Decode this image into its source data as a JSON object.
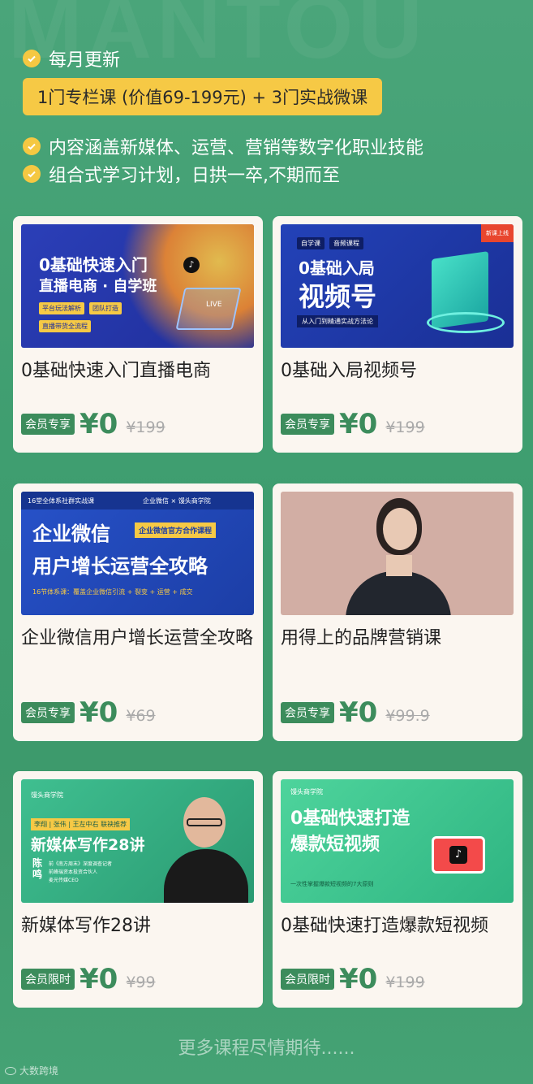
{
  "watermark": "MANTOU",
  "header": {
    "line1": "每月更新",
    "highlight": "1门专栏课 (价值69-199元) + 3门实战微课",
    "line2": "内容涵盖新媒体、运营、营销等数字化职业技能",
    "line3": "组合式学习计划，日拱一卒,不期而至"
  },
  "courses": [
    {
      "title": "0基础快速入门直播电商",
      "tag": "会员专享",
      "price": "¥0",
      "original": "¥199",
      "thumb": {
        "line1": "0基础快速入门",
        "line2": "直播电商 · 自学班",
        "chips": [
          "平台玩法解析",
          "团队打造",
          "直播带货全流程"
        ],
        "badge": "LIVE"
      }
    },
    {
      "title": "0基础入局视频号",
      "tag": "会员专享",
      "price": "¥0",
      "original": "¥199",
      "thumb": {
        "pill1": "自学课",
        "pill2": "音频课程",
        "line1": "0基础入局",
        "line2": "视频号",
        "sub": "从入门到精通实战方法论",
        "corner": "新课上线"
      }
    },
    {
      "title": "企业微信用户增长运营全攻略",
      "tag": "会员专享",
      "price": "¥0",
      "original": "¥69",
      "thumb": {
        "top": "16堂全体系社群实战课",
        "brand": "企业微信 × 馒头商学院",
        "line1": "企业微信",
        "badge": "企业微信官方合作课程",
        "line2": "用户增长运营全攻略",
        "sub": "16节体系课：覆盖企业微信引流 + 裂变 + 运营 + 成交"
      }
    },
    {
      "title": "用得上的品牌营销课",
      "tag": "会员专享",
      "price": "¥0",
      "original": "¥99.9",
      "thumb": {}
    },
    {
      "title": "新媒体写作28讲",
      "tag": "会员限时",
      "price": "¥0",
      "original": "¥99",
      "thumb": {
        "brand": "馒头商学院",
        "rec": "李翔 | 张伟 | 王左中右 联袂推荐",
        "line1": "新媒体写作28讲",
        "name": "陈鸣",
        "desc1": "前《南方周末》深度调查记者",
        "desc2": "前峰瑞资本投资合伙人",
        "desc3": "麦光传媒CEO"
      }
    },
    {
      "title": "0基础快速打造爆款短视频",
      "tag": "会员限时",
      "price": "¥0",
      "original": "¥199",
      "thumb": {
        "brand": "馒头商学院",
        "line1": "0基础快速打造",
        "line2": "爆款短视频",
        "sub": "一次性掌握爆款短视频的7大原则"
      }
    }
  ],
  "footer": "更多课程尽情期待......",
  "bottom_logo": "大数跨境",
  "colors": {
    "accent": "#3c8c5c",
    "highlight": "#f6c945",
    "card": "#fbf6f0"
  }
}
